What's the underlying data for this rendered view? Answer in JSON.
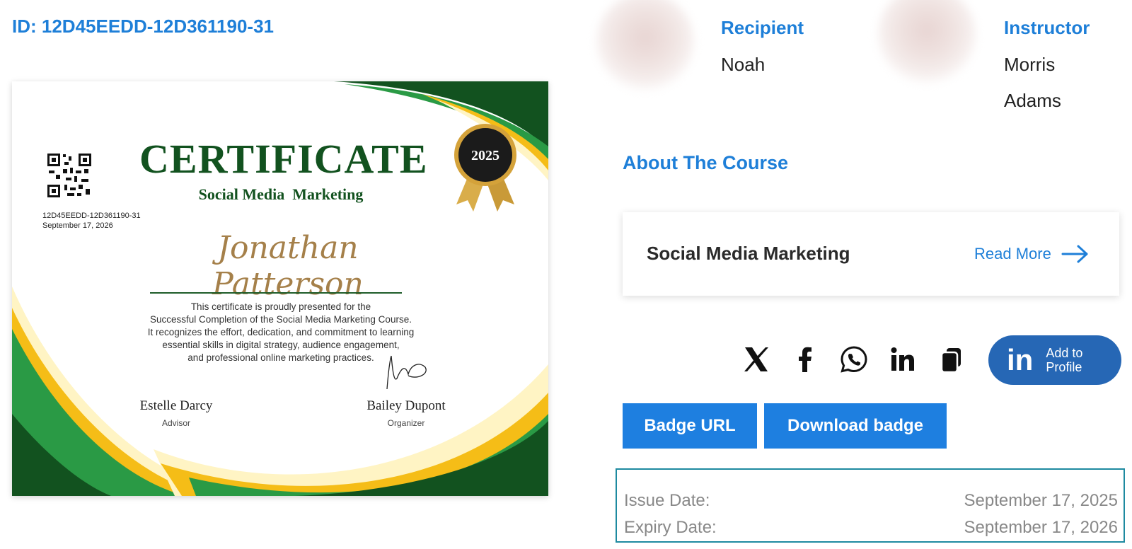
{
  "credential": {
    "id_label": "ID: 12D45EEDD-12D361190-31"
  },
  "certificate": {
    "title": "CERTIFICATE",
    "subtitle": "Social Media  Marketing",
    "year_badge": "2025",
    "recipient_name": "Jonathan Patterson",
    "id_small": "12D45EEDD-12D361190-31",
    "date_small": "September 17, 2026",
    "body_lines": [
      "This certificate is proudly presented for the",
      "Successful Completion of the Social Media Marketing Course.",
      "It recognizes the effort, dedication, and commitment to learning",
      "essential skills in digital strategy, audience engagement,",
      "and professional online marketing practices."
    ],
    "signers": [
      {
        "name": "Estelle Darcy",
        "role": "Advisor"
      },
      {
        "name": "Bailey Dupont",
        "role": "Organizer"
      }
    ],
    "colors": {
      "dark_green": "#12521f",
      "green": "#2a9a45",
      "gold": "#f5bd17",
      "cream": "#fff4c4",
      "name_gold": "#a5804a"
    }
  },
  "recipient": {
    "label": "Recipient",
    "name": "Noah"
  },
  "instructor": {
    "label": "Instructor",
    "first": "Morris",
    "last": "Adams"
  },
  "about": {
    "heading": "About The Course"
  },
  "course_card": {
    "name": "Social Media Marketing",
    "read_more": "Read More"
  },
  "share": {
    "icons": [
      "x-icon",
      "facebook-icon",
      "whatsapp-icon",
      "linkedin-icon",
      "copy-icon"
    ],
    "add_to_profile": {
      "line1": "Add to",
      "line2": "Profile",
      "logo": "in"
    }
  },
  "buttons": {
    "badge_url": "Badge URL",
    "download_badge": "Download badge"
  },
  "dates": {
    "issue_label": "Issue Date:",
    "issue_value": "September 17, 2025",
    "expiry_label": "Expiry Date:",
    "expiry_value": "September 17, 2026"
  },
  "theme": {
    "accent": "#1e7fd8",
    "button": "#1e7fe0",
    "linkedin": "#2667b5",
    "date_border": "#1e8aa0"
  }
}
